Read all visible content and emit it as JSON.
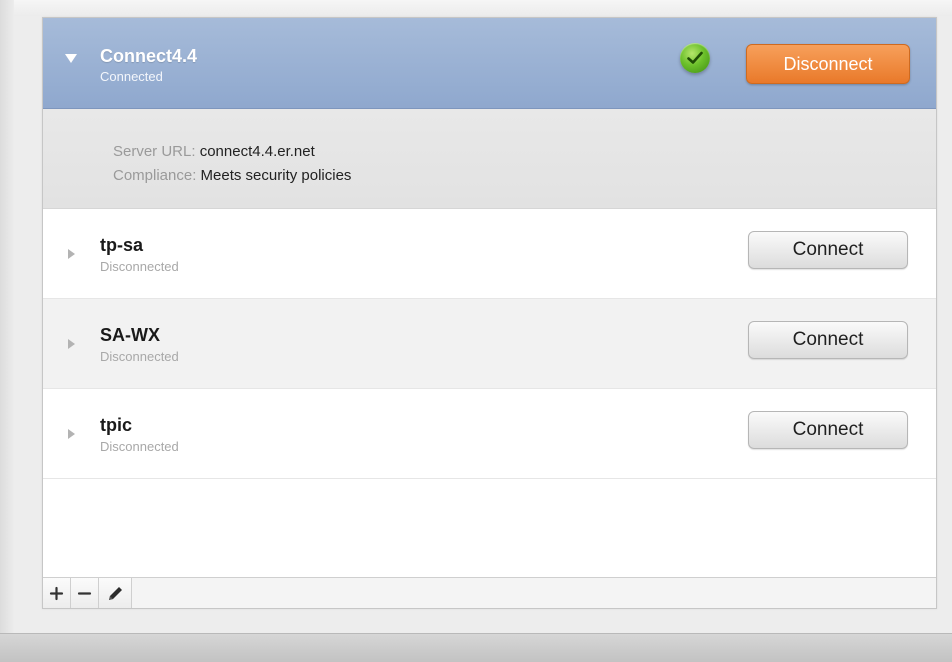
{
  "active_connection": {
    "name": "Connect4.4",
    "status": "Connected",
    "status_icon": "check-icon",
    "action_label": "Disconnect",
    "details": {
      "server_url_key": "Server URL:",
      "server_url_value": "connect4.4.er.net",
      "compliance_key": "Compliance:",
      "compliance_value": "Meets security policies"
    }
  },
  "connections": [
    {
      "name": "tp-sa",
      "status": "Disconnected",
      "action_label": "Connect"
    },
    {
      "name": "SA-WX",
      "status": "Disconnected",
      "action_label": "Connect"
    },
    {
      "name": "tpic",
      "status": "Disconnected",
      "action_label": "Connect"
    }
  ],
  "toolbar": {
    "add_label": "+",
    "remove_label": "−",
    "edit_icon": "pencil-icon"
  },
  "colors": {
    "active_header": "#9db3d5",
    "disconnect_button": "#ef8a3a",
    "check_badge": "#6cc02b"
  }
}
